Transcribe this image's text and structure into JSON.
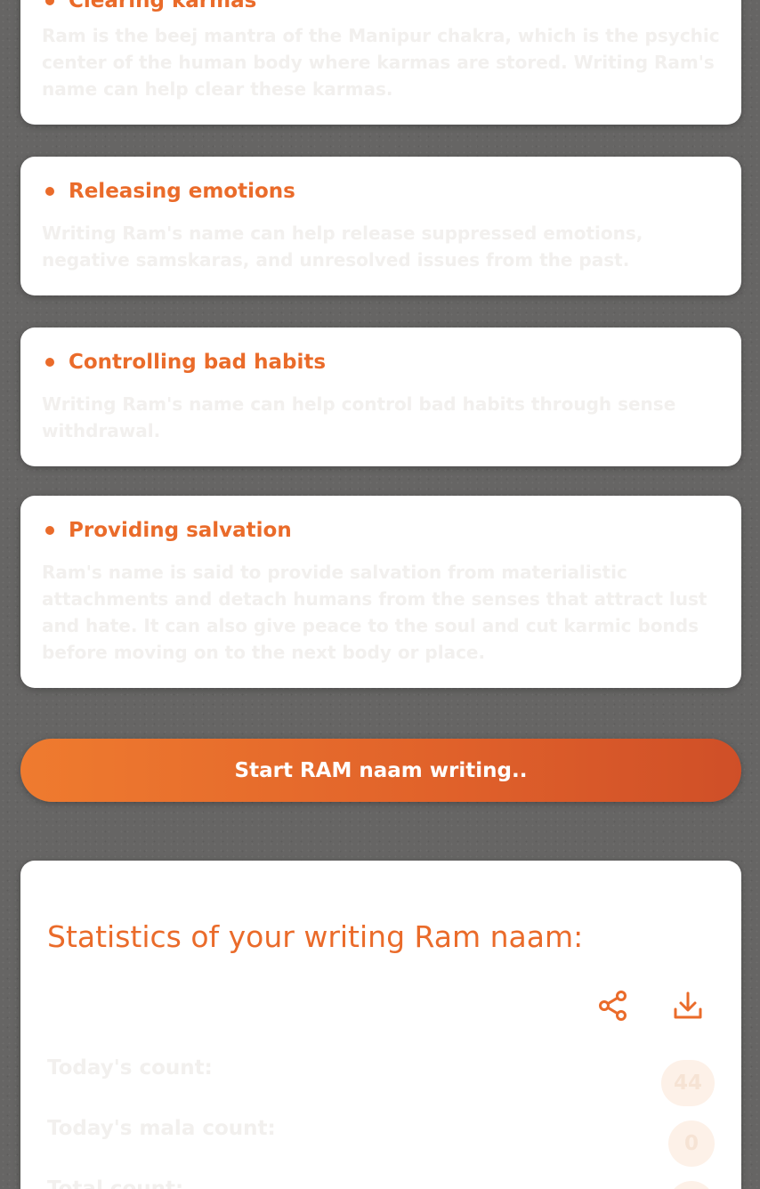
{
  "benefits": [
    {
      "title": "Clearing karmas",
      "text": "Ram is the beej mantra of the Manipur chakra, which is the psychic center of the human body where karmas are stored. Writing Ram's name can help clear these karmas."
    },
    {
      "title": "Releasing emotions",
      "text": "Writing Ram's name can help release suppressed emotions, negative samskaras, and unresolved issues from the past."
    },
    {
      "title": "Controlling bad habits",
      "text": "Writing Ram's name can help control bad habits through sense withdrawal."
    },
    {
      "title": "Providing salvation",
      "text": "Ram's name is said to provide salvation from materialistic attachments and detach humans from the senses that attract lust and hate. It can also give peace to the soul and cut karmic bonds before moving on to the next body or place."
    }
  ],
  "start_button": {
    "label": "Start RAM naam writing.."
  },
  "stats": {
    "title": "Statistics of your writing Ram naam:",
    "share_icon": "share-icon",
    "download_icon": "download-icon",
    "today_label": "Today's count:",
    "today_value": "44",
    "mala_label": "Today's mala count:",
    "mala_value": "0",
    "total_label": "Total count:",
    "total_value": ""
  },
  "colors": {
    "accent": "#ea6b2a",
    "background": "#666564",
    "card": "#ffffff"
  }
}
